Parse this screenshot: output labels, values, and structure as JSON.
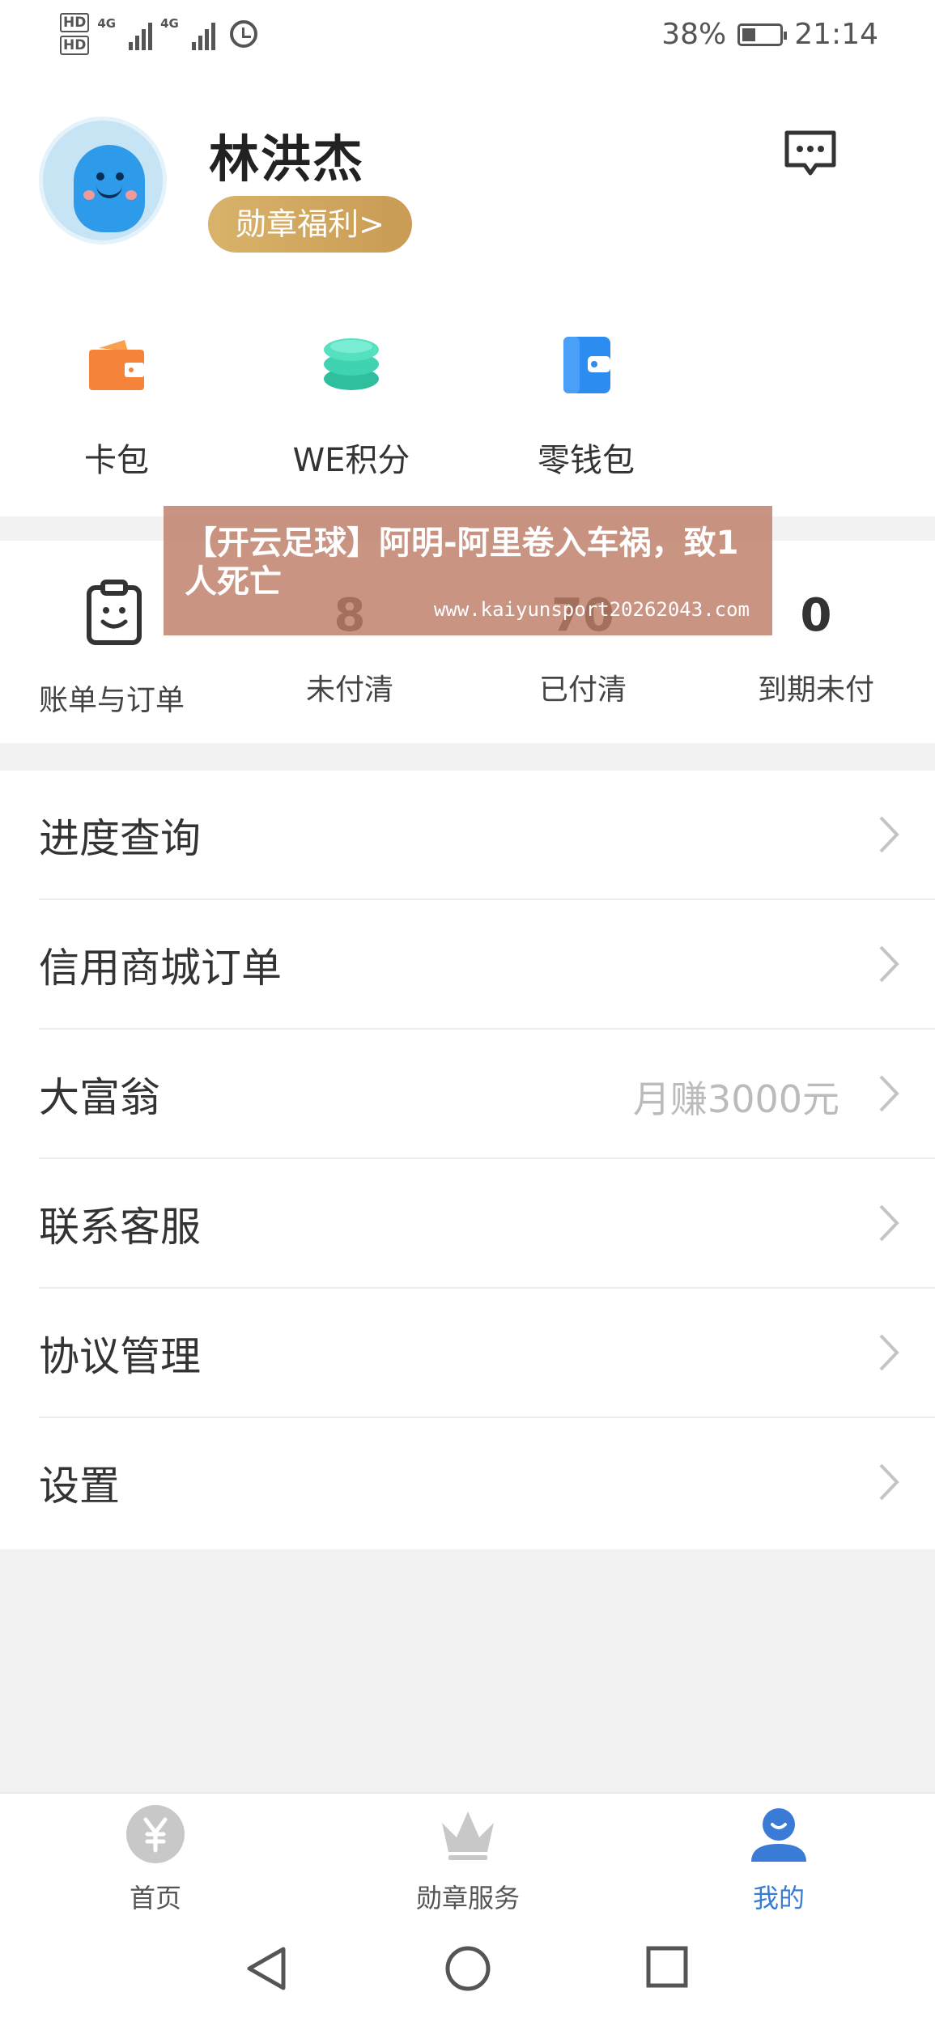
{
  "status_bar": {
    "sim1": "HD",
    "sim2": "HD",
    "network1": "4G",
    "network2": "4G",
    "battery": "38%",
    "time": "21:14"
  },
  "profile": {
    "username": "林洪杰",
    "badge_label": "勋章福利>",
    "message_icon": "message-icon"
  },
  "quick_actions": [
    {
      "label": "卡包",
      "icon": "wallet-icon",
      "color": "#f5843a"
    },
    {
      "label": "WE积分",
      "icon": "coins-icon",
      "color": "#3fd3b2"
    },
    {
      "label": "零钱包",
      "icon": "purse-icon",
      "color": "#2d8cf0"
    }
  ],
  "bills": {
    "label": "账单与订单",
    "items": [
      {
        "value": "8",
        "label": "未付清"
      },
      {
        "value": "70",
        "label": "已付清"
      },
      {
        "value": "0",
        "label": "到期未付"
      }
    ]
  },
  "menu": [
    {
      "label": "进度查询",
      "extra": ""
    },
    {
      "label": "信用商城订单",
      "extra": ""
    },
    {
      "label": "大富翁",
      "extra": "月赚3000元"
    },
    {
      "label": "联系客服",
      "extra": ""
    },
    {
      "label": "协议管理",
      "extra": ""
    },
    {
      "label": "设置",
      "extra": ""
    }
  ],
  "overlay": {
    "title": "【开云足球】阿明-阿里卷入车祸，致1人死亡",
    "url": "www.kaiyunsport20262043.com"
  },
  "tabbar": [
    {
      "label": "首页",
      "icon": "yen-icon",
      "active": false
    },
    {
      "label": "勋章服务",
      "icon": "crown-icon",
      "active": false
    },
    {
      "label": "我的",
      "icon": "user-icon",
      "active": true
    }
  ],
  "colors": {
    "accent": "#3a7bd5",
    "badge_gold": "#d4a962",
    "banner": "#be7c68"
  }
}
